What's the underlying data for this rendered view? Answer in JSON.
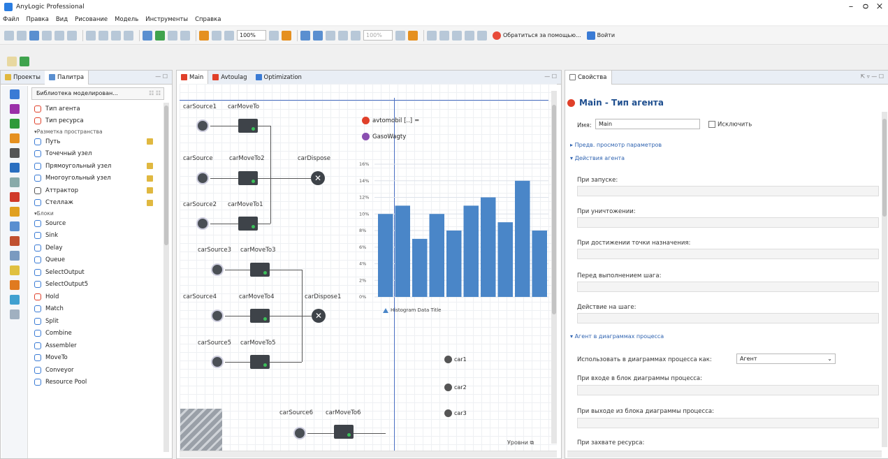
{
  "window": {
    "title": "AnyLogic Professional",
    "controls": [
      "–",
      "ᴑ",
      "×"
    ]
  },
  "menu": [
    "Файл",
    "Правка",
    "Вид",
    "Рисование",
    "Модель",
    "Инструменты",
    "Справка"
  ],
  "toolbar": {
    "zoom1": "100%",
    "zoom2": "100%",
    "help_label": "Обратиться за помощью...",
    "login_label": "Войти"
  },
  "left_panel": {
    "tabs": [
      "Проекты",
      "Палитра"
    ],
    "library_header": "Библиотека моделирован...",
    "items": [
      {
        "label": "Тип агента",
        "kind": "item"
      },
      {
        "label": "Тип ресурса",
        "kind": "item"
      },
      {
        "label": "Разметка пространства",
        "kind": "section"
      },
      {
        "label": "Путь",
        "kind": "item",
        "wand": true
      },
      {
        "label": "Точечный узел",
        "kind": "item"
      },
      {
        "label": "Прямоугольный узел",
        "kind": "item",
        "wand": true
      },
      {
        "label": "Многоугольный узел",
        "kind": "item",
        "wand": true
      },
      {
        "label": "Аттрактор",
        "kind": "item",
        "wand": true
      },
      {
        "label": "Стеллаж",
        "kind": "item",
        "wand": true
      },
      {
        "label": "Блоки",
        "kind": "section"
      },
      {
        "label": "Source",
        "kind": "item"
      },
      {
        "label": "Sink",
        "kind": "item"
      },
      {
        "label": "Delay",
        "kind": "item"
      },
      {
        "label": "Queue",
        "kind": "item"
      },
      {
        "label": "SelectOutput",
        "kind": "item"
      },
      {
        "label": "SelectOutput5",
        "kind": "item"
      },
      {
        "label": "Hold",
        "kind": "item"
      },
      {
        "label": "Match",
        "kind": "item"
      },
      {
        "label": "Split",
        "kind": "item"
      },
      {
        "label": "Combine",
        "kind": "item"
      },
      {
        "label": "Assembler",
        "kind": "item"
      },
      {
        "label": "MoveTo",
        "kind": "item"
      },
      {
        "label": "Conveyor",
        "kind": "item"
      },
      {
        "label": "Resource Pool",
        "kind": "item"
      }
    ]
  },
  "editor": {
    "tabs": [
      "Main",
      "Avtoulag",
      "Optimization"
    ],
    "blocks": {
      "carSource1": "carSource1",
      "carMoveTo": "carMoveTo",
      "carSource": "carSource",
      "carMoveTo2": "carMoveTo2",
      "carDispose": "carDispose",
      "carSource2": "carSource2",
      "carMoveTo1": "carMoveTo1",
      "carSource3": "carSource3",
      "carMoveTo3": "carMoveTo3",
      "carSource4": "carSource4",
      "carMoveTo4": "carMoveTo4",
      "carDispose1": "carDispose1",
      "carSource5": "carSource5",
      "carMoveTo5": "carMoveTo5",
      "carSource6": "carSource6",
      "carMoveTo6": "carMoveTo6"
    },
    "agent_pop": "avtomobil [..]",
    "gas_agent": "GasoWagty",
    "cars": [
      "car1",
      "car2",
      "car3"
    ],
    "levels_label": "Уровни"
  },
  "chart_data": {
    "type": "bar",
    "title": "",
    "legend": [
      "Histogram Data Title"
    ],
    "ylim": [
      0,
      16
    ],
    "yticks": [
      "0%",
      "2%",
      "4%",
      "6%",
      "8%",
      "10%",
      "12%",
      "14%",
      "16%"
    ],
    "values": [
      10,
      11,
      7,
      10,
      8,
      11,
      12,
      9,
      14,
      8
    ]
  },
  "properties": {
    "tab": "Свойства",
    "title": "Main - Тип агента",
    "name_label": "Имя:",
    "name_value": "Main",
    "exclude_label": "Исключить",
    "section_preview": "Предв. просмотр параметров",
    "section_actions": "Действия агента",
    "on_startup": "При запуске:",
    "on_destroy": "При уничтожении:",
    "on_arrival": "При достижении точки назначения:",
    "before_step": "Перед выполнением шага:",
    "on_step": "Действие на шаге:",
    "section_process": "Агент в диаграммах процесса",
    "use_as_label": "Использовать в диаграммах процесса как:",
    "use_as_value": "Агент",
    "on_enter": "При входе в блок диаграммы процесса:",
    "on_exit": "При выходе из блока диаграммы процесса:",
    "on_seize": "При захвате ресурса:"
  }
}
